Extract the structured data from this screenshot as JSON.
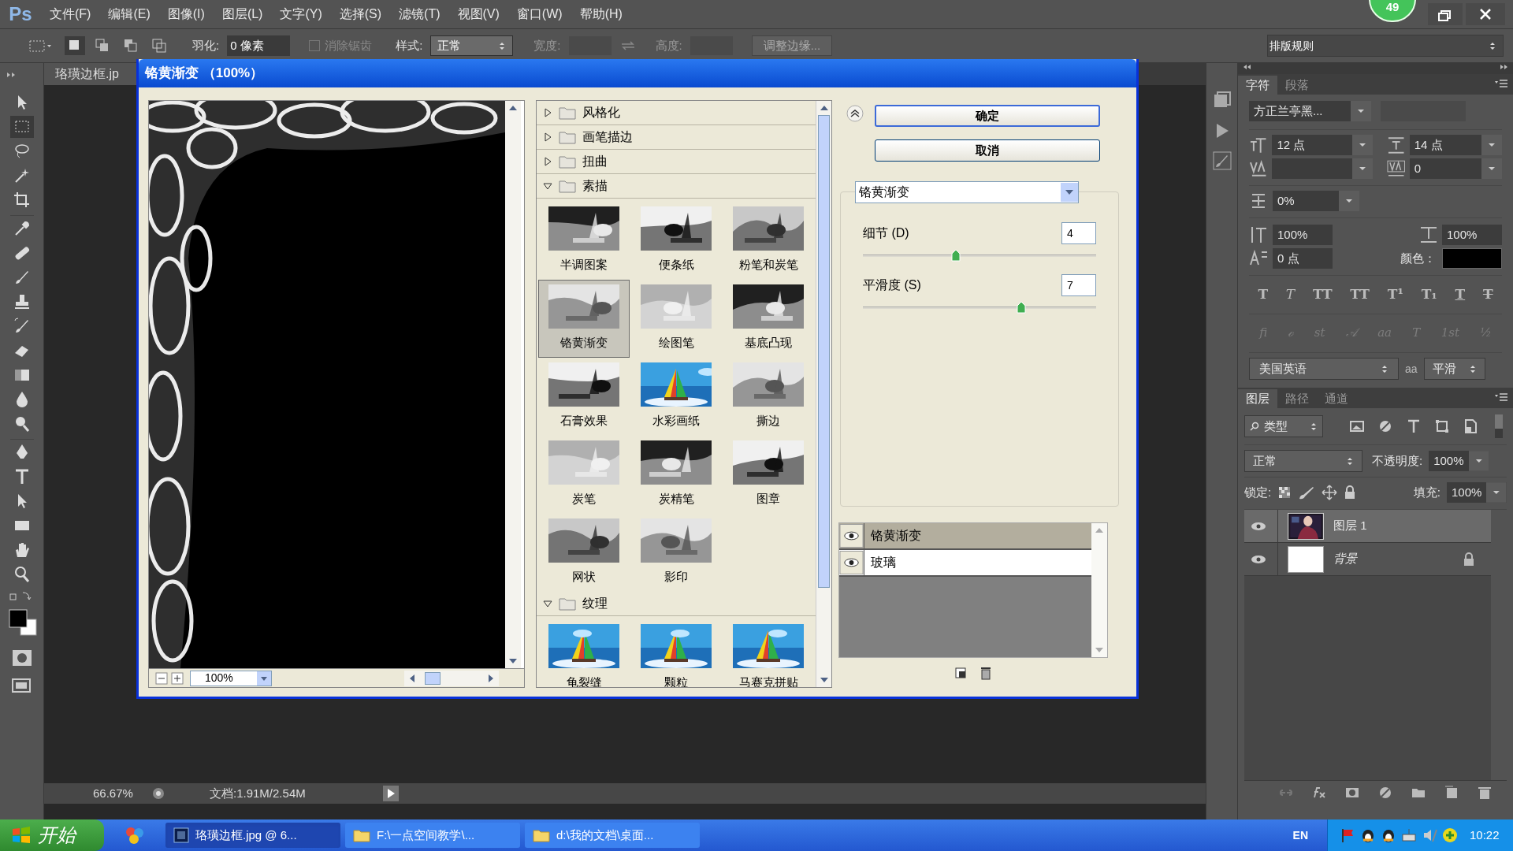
{
  "menu": [
    "文件(F)",
    "编辑(E)",
    "图像(I)",
    "图层(L)",
    "文字(Y)",
    "选择(S)",
    "滤镜(T)",
    "视图(V)",
    "窗口(W)",
    "帮助(H)"
  ],
  "app_logo": "Ps",
  "status_badge": "49",
  "options_bar": {
    "feather_label": "羽化:",
    "feather_value": "0 像素",
    "antialias": {
      "label": "消除锯齿",
      "checked": false,
      "disabled": true
    },
    "style_label": "样式:",
    "style_value": "正常",
    "width_label": "宽度:",
    "height_label": "高度:",
    "refine_button": "调整边缘...",
    "workspace": "排版规则"
  },
  "document_tab": "珞璜边框.jp",
  "tools": [
    {
      "selected": false
    },
    {
      "selected": true
    },
    {
      "selected": false
    },
    {
      "selected": false
    },
    {
      "selected": false
    },
    {
      "selected": false
    },
    {
      "selected": false
    },
    {
      "selected": false
    },
    {
      "selected": false
    },
    {
      "selected": false
    },
    {
      "selected": false
    },
    {
      "selected": false
    },
    {
      "selected": false
    },
    {
      "selected": false
    },
    {
      "selected": false
    },
    {
      "selected": false
    },
    {
      "selected": false
    },
    {
      "selected": false
    },
    {
      "selected": false
    },
    {
      "selected": false
    }
  ],
  "status_bar": {
    "zoom": "66.67%",
    "doc_size": "文档:1.91M/2.54M"
  },
  "dialog": {
    "title": "铬黄渐变 （100%）",
    "preview_zoom": "100%",
    "filter_groups": [
      {
        "name": "风格化",
        "expanded": false
      },
      {
        "name": "画笔描边",
        "expanded": false
      },
      {
        "name": "扭曲",
        "expanded": false
      },
      {
        "name": "素描",
        "expanded": true,
        "filters": [
          {
            "label": "半调图案",
            "selected": false
          },
          {
            "label": "便条纸",
            "selected": false
          },
          {
            "label": "粉笔和炭笔",
            "selected": false
          },
          {
            "label": "铬黄渐变",
            "selected": true
          },
          {
            "label": "绘图笔",
            "selected": false
          },
          {
            "label": "基底凸现",
            "selected": false
          },
          {
            "label": "石膏效果",
            "selected": false
          },
          {
            "label": "水彩画纸",
            "selected": false
          },
          {
            "label": "撕边",
            "selected": false
          },
          {
            "label": "炭笔",
            "selected": false
          },
          {
            "label": "炭精笔",
            "selected": false
          },
          {
            "label": "图章",
            "selected": false
          },
          {
            "label": "网状",
            "selected": false
          },
          {
            "label": "影印",
            "selected": false
          }
        ]
      },
      {
        "name": "纹理",
        "expanded": true,
        "filters": [
          {
            "label": "龟裂缝",
            "selected": false
          },
          {
            "label": "颗粒",
            "selected": false
          },
          {
            "label": "马赛克拼贴",
            "selected": false
          }
        ]
      }
    ],
    "ok_button": "确定",
    "cancel_button": "取消",
    "filter_select": "铬黄渐变",
    "params": [
      {
        "label": "细节 (D)",
        "value": "4",
        "level": 0.4
      },
      {
        "label": "平滑度 (S)",
        "value": "7",
        "level": 0.68
      }
    ],
    "effect_layers": [
      {
        "name": "铬黄渐变",
        "selected": true,
        "visible": true
      },
      {
        "name": "玻璃",
        "selected": false,
        "visible": true
      }
    ]
  },
  "character_panel": {
    "tabs": [
      {
        "label": "字符",
        "selected": true
      },
      {
        "label": "段落",
        "selected": false
      }
    ],
    "font_family": "方正兰亭黑...",
    "font_size": "12 点",
    "leading": "14 点",
    "tracking": "0",
    "tsume": "0%",
    "vertical_scale": "100%",
    "horizontal_scale": "100%",
    "baseline_shift": "0 点",
    "color_label": "颜色：",
    "style_buttons": [
      {
        "glyph": "T",
        "kind": "bold"
      },
      {
        "glyph": "T",
        "kind": "italic"
      },
      {
        "glyph": "TT",
        "kind": "caps"
      },
      {
        "glyph": "TT",
        "kind": "smallcaps"
      },
      {
        "glyph": "T¹",
        "kind": "super"
      },
      {
        "glyph": "T₁",
        "kind": "sub"
      },
      {
        "glyph": "T",
        "kind": "underline"
      },
      {
        "glyph": "T",
        "kind": "strike"
      }
    ],
    "opentype_buttons": [
      "fi",
      "ℴ",
      "st",
      "𝒜",
      "aa",
      "T",
      "1st",
      "½"
    ],
    "language": "美国英语",
    "antialias_glyph": "aa",
    "antialias": "平滑"
  },
  "layers_panel": {
    "tabs": [
      {
        "label": "图层",
        "selected": true
      },
      {
        "label": "路径",
        "selected": false
      },
      {
        "label": "通道",
        "selected": false
      }
    ],
    "filter_kind": "类型",
    "blend_mode": "正常",
    "opacity_label": "不透明度:",
    "opacity": "100%",
    "lock_label": "锁定:",
    "fill_label": "填充:",
    "fill": "100%",
    "layers": [
      {
        "name": "图层 1",
        "selected": true,
        "visible": true,
        "locked": false
      },
      {
        "name": "背景",
        "kind": "background",
        "selected": false,
        "visible": true,
        "locked": true
      }
    ]
  },
  "taskbar": {
    "start": "开始",
    "tasks": [
      {
        "label": "珞璜边框.jpg @ 6...",
        "kind": "ps",
        "selected": true
      },
      {
        "label": "F:\\一点空间教学\\...",
        "kind": "folder",
        "selected": false
      },
      {
        "label": "d:\\我的文档\\桌面...",
        "kind": "folder",
        "selected": false
      }
    ],
    "language": "EN",
    "clock": "10:22"
  }
}
